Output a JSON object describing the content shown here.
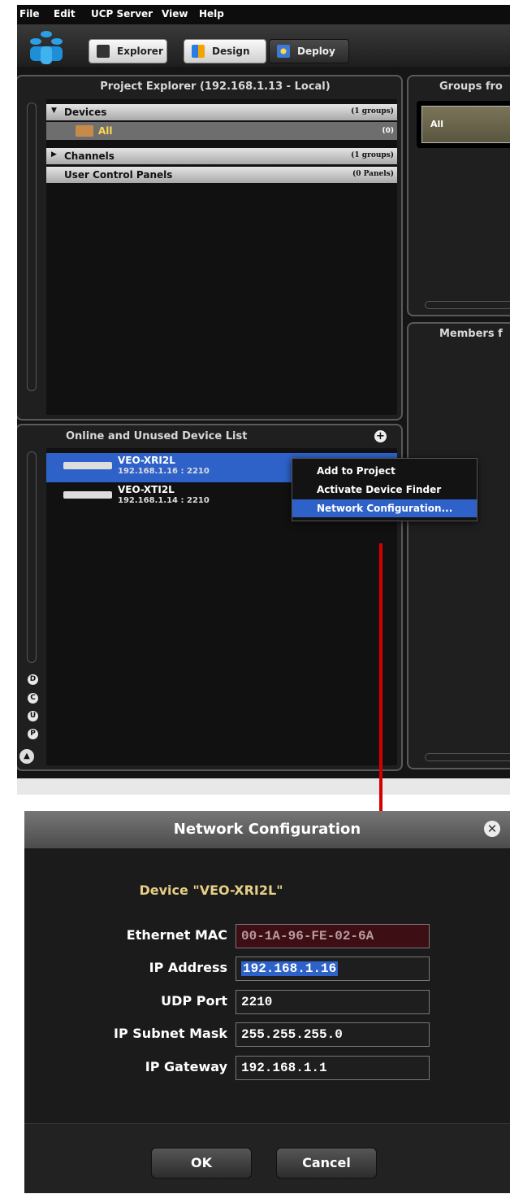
{
  "menubar": {
    "items": [
      "File",
      "Edit",
      "UCP Server",
      "View",
      "Help"
    ]
  },
  "toolbar": {
    "explorer": "Explorer",
    "design": "Design",
    "deploy": "Deploy"
  },
  "project_explorer": {
    "title": "Project Explorer (192.168.1.13 - Local)",
    "rows": [
      {
        "label": "Devices",
        "count": "(1 groups)"
      },
      {
        "label": "All",
        "count": "(0)"
      },
      {
        "label": "Channels",
        "count": "(1 groups)"
      },
      {
        "label": "User Control Panels",
        "count": "(0 Panels)"
      }
    ]
  },
  "groups_panel": {
    "title": "Groups fro",
    "item": "All"
  },
  "members_panel": {
    "title": "Members f"
  },
  "device_list": {
    "title": "Online and Unused Device List",
    "devices": [
      {
        "name": "VEO-XRI2L",
        "address": "192.168.1.16 : 2210"
      },
      {
        "name": "VEO-XTI2L",
        "address": "192.168.1.14 : 2210"
      }
    ],
    "side_letters": [
      "D",
      "C",
      "U",
      "P"
    ]
  },
  "context_menu": {
    "items": [
      "Add to Project",
      "Activate Device Finder",
      "Network Configuration..."
    ]
  },
  "dialog": {
    "title": "Network Configuration",
    "device": "Device \"VEO-XRI2L\"",
    "fields": [
      {
        "label": "Ethernet MAC",
        "value": "00-1A-96-FE-02-6A"
      },
      {
        "label": "IP Address",
        "value": "192.168.1.16"
      },
      {
        "label": "UDP Port",
        "value": "2210"
      },
      {
        "label": "IP Subnet Mask",
        "value": "255.255.255.0"
      },
      {
        "label": "IP Gateway",
        "value": "192.168.1.1"
      }
    ],
    "ok": "OK",
    "cancel": "Cancel"
  },
  "colors": {
    "accent": "#2e62c9",
    "arrow": "#d40000",
    "device_label": "#e7cf86",
    "mac_bg": "#3d0f14"
  }
}
